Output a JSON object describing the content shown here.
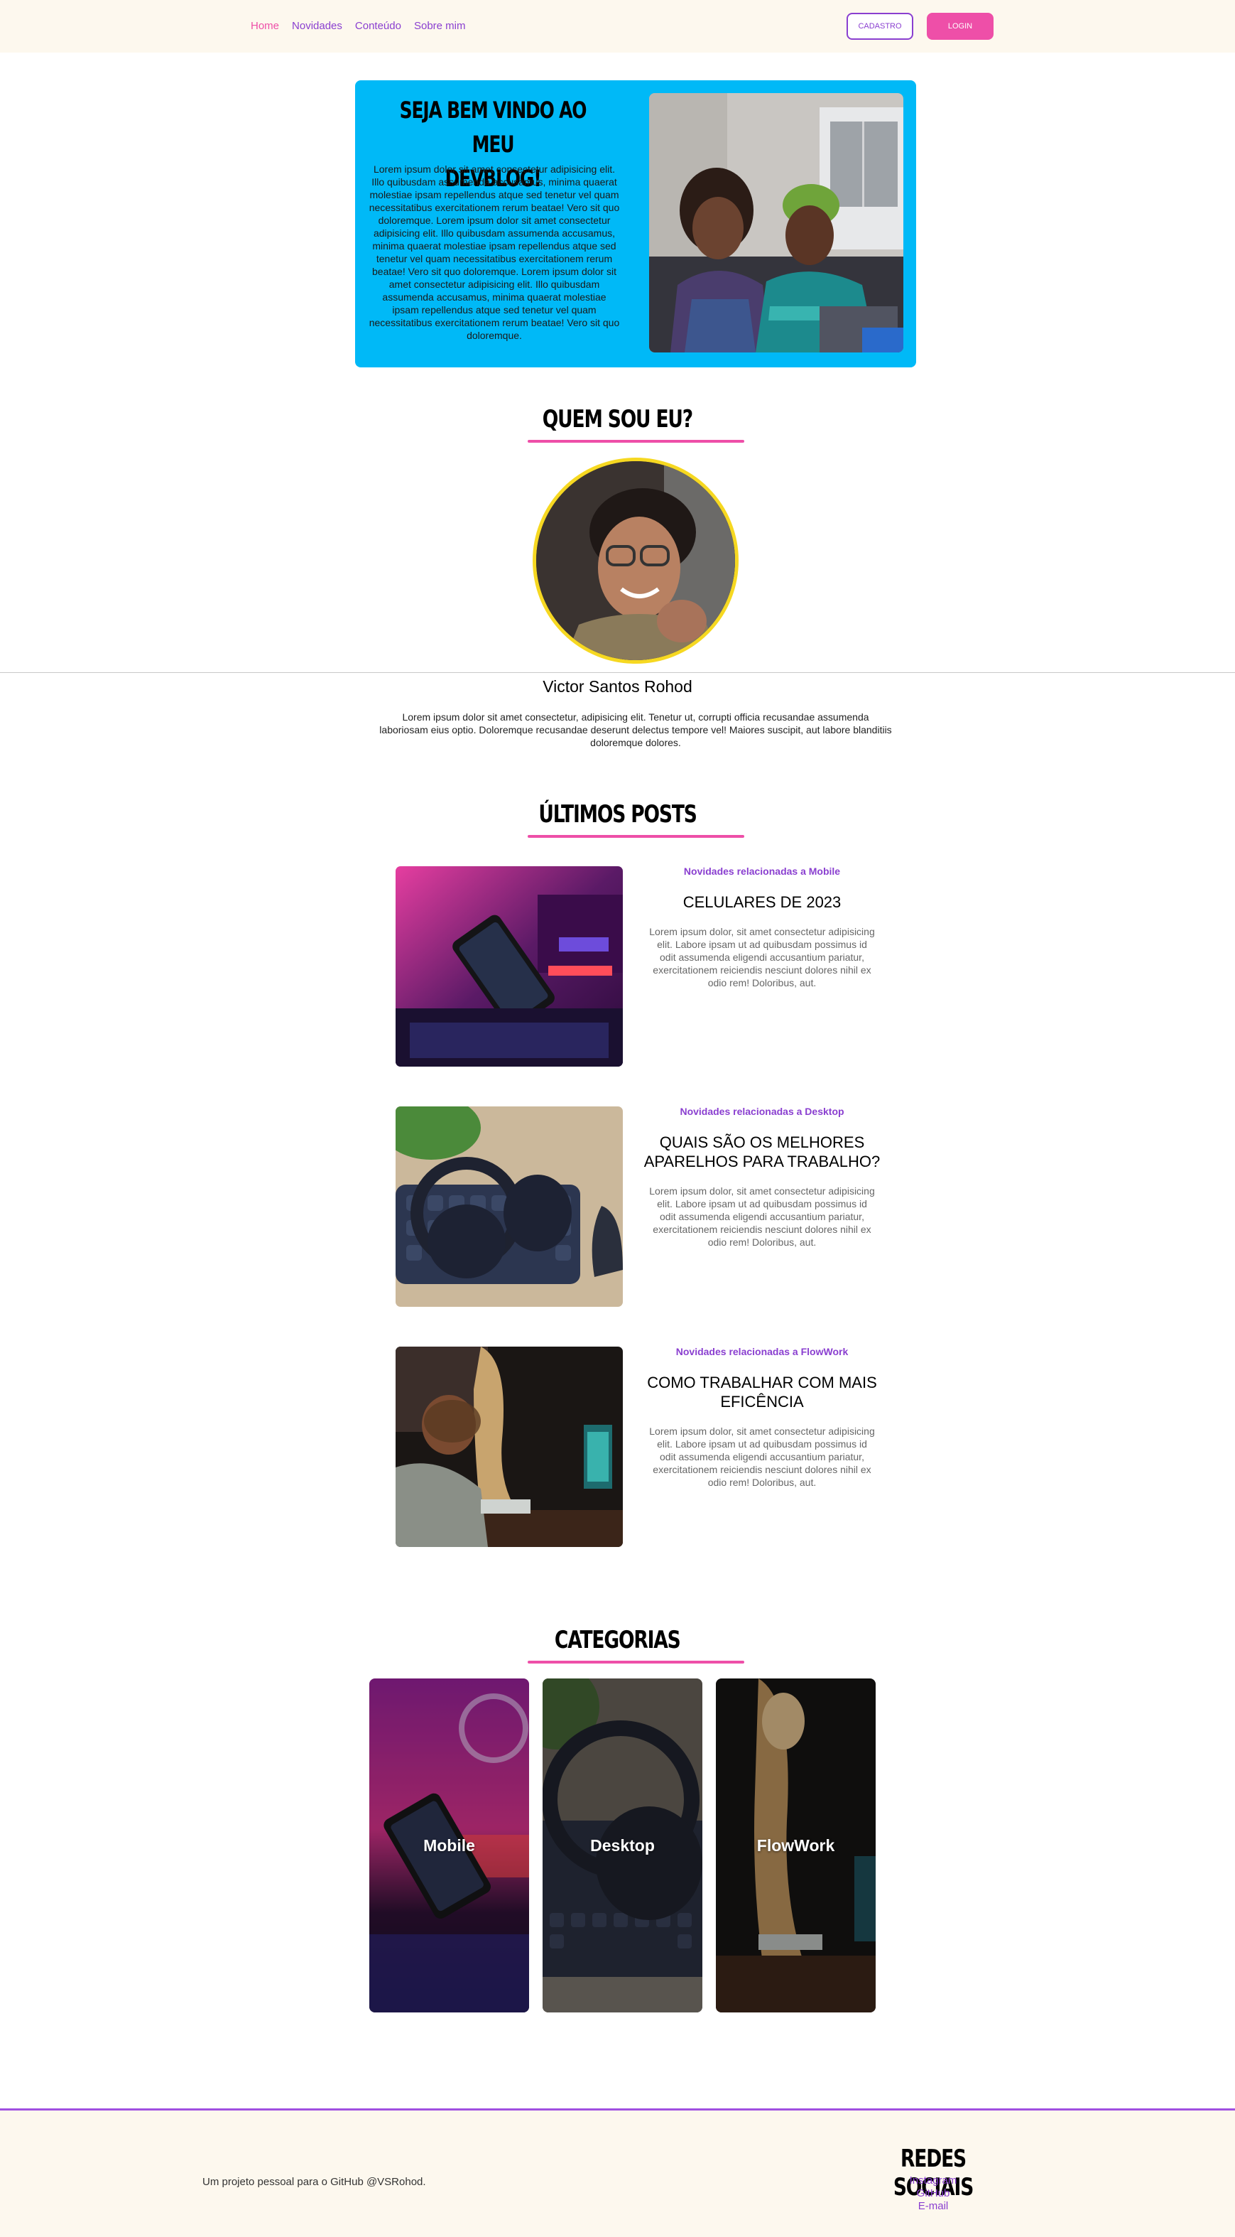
{
  "nav": {
    "links": [
      {
        "label": "Home",
        "active": true
      },
      {
        "label": "Novidades"
      },
      {
        "label": "Conteúdo"
      },
      {
        "label": "Sobre mim"
      }
    ],
    "cadastro_label": "CADASTRO",
    "login_label": "LOGIN"
  },
  "hero": {
    "title_line1": "SEJA BEM VINDO AO MEU",
    "title_line2": "DEVBLOG!",
    "paragraph": "Lorem ipsum dolor sit amet consectetur adipisicing elit. Illo quibusdam assumenda accusamus, minima quaerat molestiae ipsam repellendus atque sed tenetur vel quam necessitatibus exercitationem rerum beatae! Vero sit quo doloremque. Lorem ipsum dolor sit amet consectetur adipisicing elit. Illo quibusdam assumenda accusamus, minima quaerat molestiae ipsam repellendus atque sed tenetur vel quam necessitatibus exercitationem rerum beatae! Vero sit quo doloremque. Lorem ipsum dolor sit amet consectetur adipisicing elit. Illo quibusdam assumenda accusamus, minima quaerat molestiae ipsam repellendus atque sed tenetur vel quam necessitatibus exercitationem rerum beatae! Vero sit quo doloremque."
  },
  "about": {
    "heading": "QUEM SOU EU?",
    "name": "Victor Santos Rohod",
    "text": "Lorem ipsum dolor sit amet consectetur, adipisicing elit. Tenetur ut, corrupti officia recusandae assumenda laboriosam eius optio. Doloremque recusandae deserunt delectus tempore vel! Maiores suscipit, aut labore blanditiis doloremque dolores."
  },
  "posts": {
    "heading": "ÚLTIMOS POSTS",
    "items": [
      {
        "category": "Novidades relacionadas a Mobile",
        "title": "CELULARES DE 2023",
        "body": "Lorem ipsum dolor, sit amet consectetur adipisicing elit. Labore ipsam ut ad quibusdam possimus id odit assumenda eligendi accusantium pariatur, exercitationem reiciendis nesciunt dolores nihil ex odio rem! Doloribus, aut."
      },
      {
        "category": "Novidades relacionadas a Desktop",
        "title": "QUAIS SÃO OS MELHORES APARELHOS PARA TRABALHO?",
        "body": "Lorem ipsum dolor, sit amet consectetur adipisicing elit. Labore ipsam ut ad quibusdam possimus id odit assumenda eligendi accusantium pariatur, exercitationem reiciendis nesciunt dolores nihil ex odio rem! Doloribus, aut."
      },
      {
        "category": "Novidades relacionadas a FlowWork",
        "title": "COMO TRABALHAR COM MAIS EFICÊNCIA",
        "body": "Lorem ipsum dolor, sit amet consectetur adipisicing elit. Labore ipsam ut ad quibusdam possimus id odit assumenda eligendi accusantium pariatur, exercitationem reiciendis nesciunt dolores nihil ex odio rem! Doloribus, aut."
      }
    ]
  },
  "categories": {
    "heading": "CATEGORIAS",
    "items": [
      {
        "label": "Mobile"
      },
      {
        "label": "Desktop"
      },
      {
        "label": "FlowWork"
      }
    ]
  },
  "footer": {
    "text": "Um projeto pessoal para o GitHub @VSRohod.",
    "social_title": "REDES SOCIAIS",
    "links": [
      {
        "label": "Instagram"
      },
      {
        "label": "GitHub"
      },
      {
        "label": "E-mail"
      }
    ]
  },
  "colors": {
    "accent_pink": "#ee4fa8",
    "accent_purple": "#8a3fd0",
    "hero_blue": "#00b9f7",
    "avatar_border": "#f6d821",
    "header_bg": "#fdf8ee"
  }
}
